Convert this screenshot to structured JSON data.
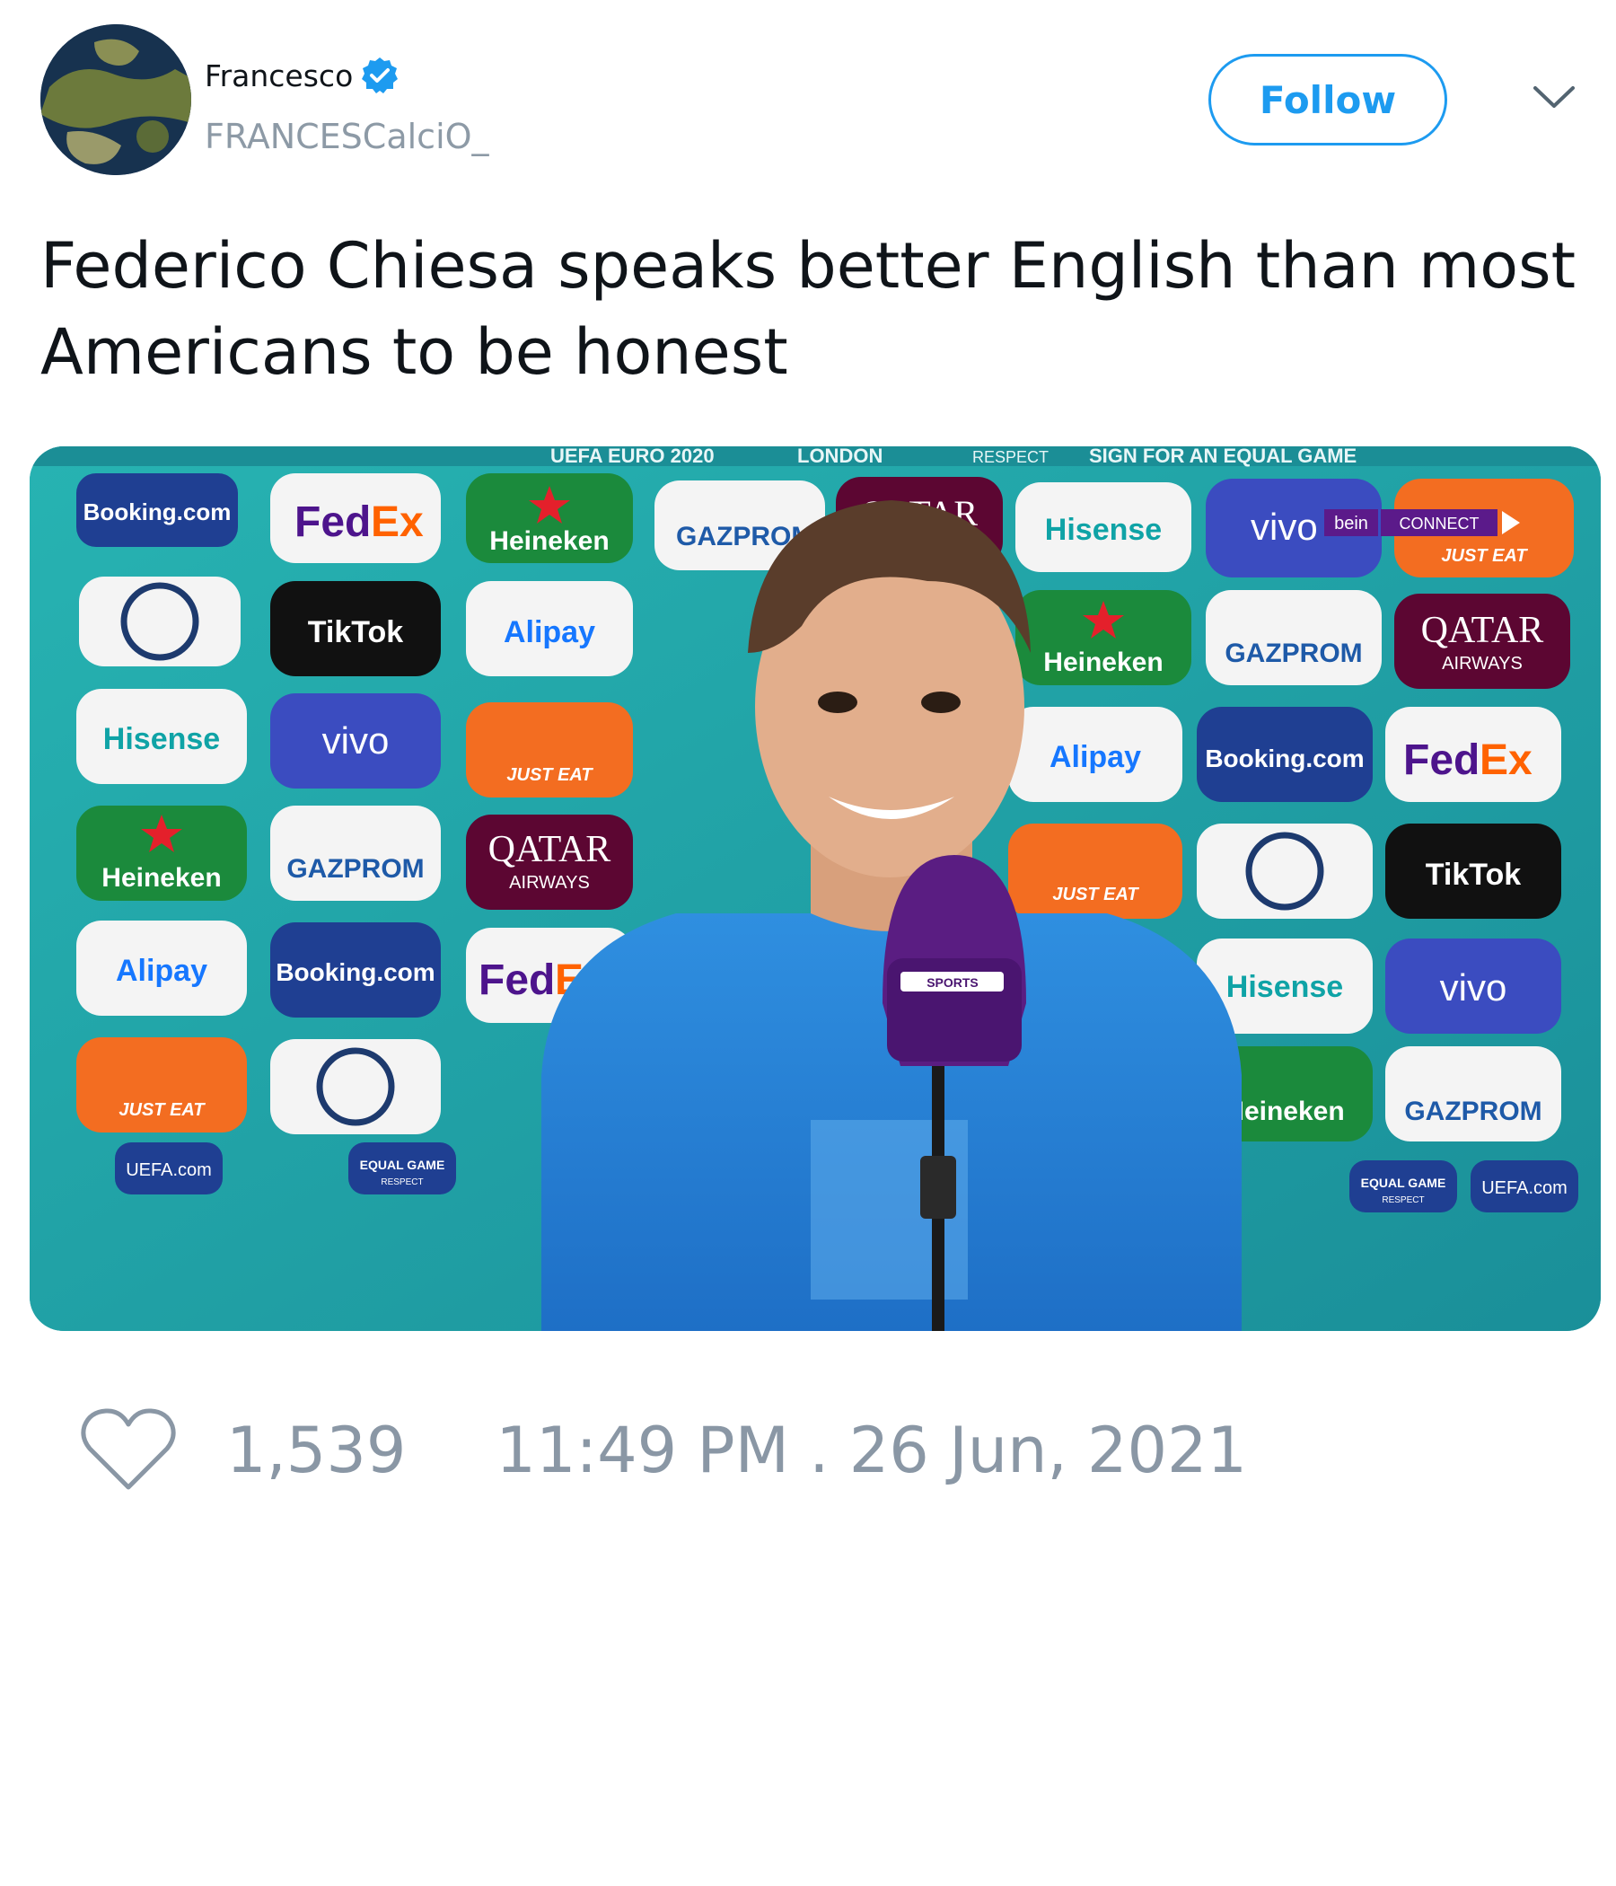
{
  "author": {
    "name": "Francesco",
    "handle": "FRANCESCalciO_",
    "verified_icon": "verified-badge-icon"
  },
  "actions": {
    "follow_label": "Follow",
    "menu_icon": "chevron-down-icon"
  },
  "tweet": {
    "text": "Federico Chiesa speaks better English than most Americans to be honest"
  },
  "media": {
    "banner": "UEFA EURO 2020",
    "banner_city": "LONDON",
    "banner_respect": "RESPECT",
    "banner_slogan": "SIGN FOR AN EQUAL GAME",
    "sponsors": {
      "booking": "Booking.com",
      "fedex_a": "Fed",
      "fedex_b": "Ex",
      "heineken": "Heineken",
      "gazprom": "GAZPROM",
      "qatar": "QATAR",
      "qatar_sub": "AIRWAYS",
      "hisense": "Hisense",
      "vivo": "vivo",
      "tiktok": "TikTok",
      "alipay": "Alipay",
      "justeat": "JUST EAT",
      "uefa": "UEFA.com",
      "equal": "EQUAL GAME",
      "respect": "RESPECT"
    },
    "bein_connect": "CONNECT",
    "bein_logo": "bein",
    "mic_label": "SPORTS"
  },
  "stats": {
    "likes": "1,539",
    "timestamp": "11:49 PM . 26 Jun, 2021"
  },
  "colors": {
    "accent": "#1d9bf0",
    "muted": "#8a97a5",
    "board": "#1fa3a6"
  }
}
